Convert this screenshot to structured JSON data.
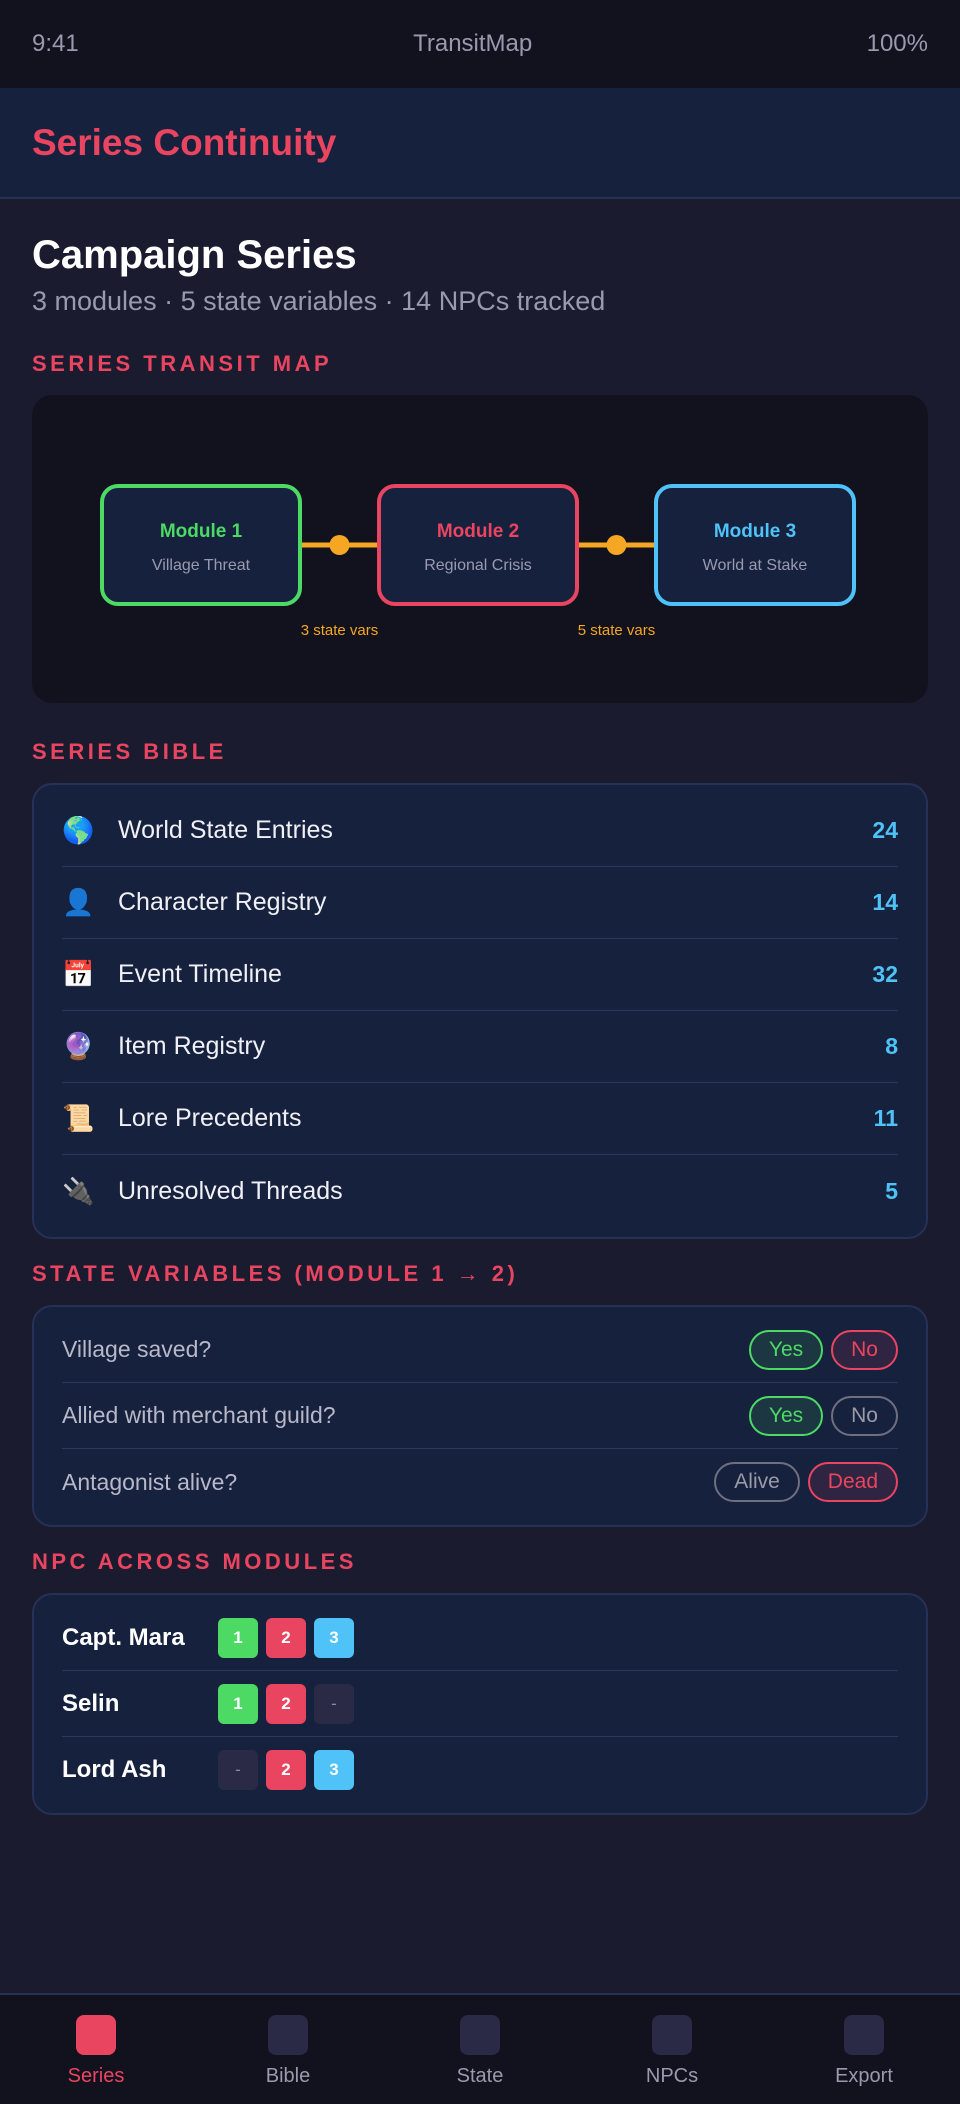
{
  "status_bar": {
    "time": "9:41",
    "app_name": "TransitMap",
    "battery": "100%"
  },
  "header": {
    "title": "Series Continuity"
  },
  "page": {
    "title": "Campaign Series",
    "subtitle": "3 modules · 5 state variables · 14 NPCs tracked"
  },
  "transit_map": {
    "section_label": "Series Transit Map",
    "modules": [
      {
        "title": "Module 1",
        "subtitle": "Village Threat",
        "color": "#4cd964"
      },
      {
        "title": "Module 2",
        "subtitle": "Regional Crisis",
        "color": "#e94560"
      },
      {
        "title": "Module 3",
        "subtitle": "World at Stake",
        "color": "#4fc3f7"
      }
    ],
    "connectors": [
      {
        "label": "3 state vars",
        "color": "#f5a623"
      },
      {
        "label": "5 state vars",
        "color": "#f5a623"
      }
    ]
  },
  "bible": {
    "section_label": "Series Bible",
    "items": [
      {
        "icon": "globe-icon",
        "emoji": "🌎",
        "label": "World State Entries",
        "count": "24"
      },
      {
        "icon": "person-icon",
        "emoji": "👤",
        "label": "Character Registry",
        "count": "14"
      },
      {
        "icon": "calendar-icon",
        "emoji": "📅",
        "label": "Event Timeline",
        "count": "32"
      },
      {
        "icon": "crystal-ball-icon",
        "emoji": "🔮",
        "label": "Item Registry",
        "count": "8"
      },
      {
        "icon": "scroll-icon",
        "emoji": "📜",
        "label": "Lore Precedents",
        "count": "11"
      },
      {
        "icon": "plug-icon",
        "emoji": "🔌",
        "label": "Unresolved Threads",
        "count": "5"
      }
    ]
  },
  "state_variables": {
    "section_label": "State Variables (Module 1 → 2)",
    "rows": [
      {
        "question": "Village saved?",
        "options": [
          {
            "label": "Yes",
            "style": "green"
          },
          {
            "label": "No",
            "style": "red"
          }
        ]
      },
      {
        "question": "Allied with merchant guild?",
        "options": [
          {
            "label": "Yes",
            "style": "green"
          },
          {
            "label": "No",
            "style": "neutral"
          }
        ]
      },
      {
        "question": "Antagonist alive?",
        "options": [
          {
            "label": "Alive",
            "style": "neutral"
          },
          {
            "label": "Dead",
            "style": "red"
          }
        ]
      }
    ]
  },
  "npcs": {
    "section_label": "NPC Across Modules",
    "rows": [
      {
        "name": "Capt. Mara",
        "modules": [
          "1",
          "2",
          "3"
        ]
      },
      {
        "name": "Selin",
        "modules": [
          "1",
          "2",
          "-"
        ]
      },
      {
        "name": "Lord Ash",
        "modules": [
          "-",
          "2",
          "3"
        ]
      }
    ]
  },
  "tab_bar": {
    "tabs": [
      {
        "label": "Series",
        "active": true
      },
      {
        "label": "Bible",
        "active": false
      },
      {
        "label": "State",
        "active": false
      },
      {
        "label": "NPCs",
        "active": false
      },
      {
        "label": "Export",
        "active": false
      }
    ]
  },
  "colors": {
    "accent": "#e94560",
    "module_1": "#4cd964",
    "module_2": "#e94560",
    "module_3": "#4fc3f7",
    "connector": "#f5a623",
    "count": "#4fc3f7"
  }
}
